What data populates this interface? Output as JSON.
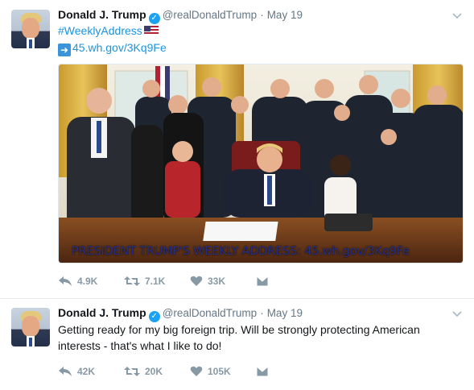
{
  "tweets": [
    {
      "author": {
        "name": "Donald J. Trump",
        "handle": "@realDonaldTrump",
        "verified_icon": "verified-badge-icon"
      },
      "time": "May 19",
      "lines": {
        "hashtag": "#WeeklyAddress",
        "link": "45.wh.gov/3Kq9Fe"
      },
      "media": {
        "caption": "PRESIDENT TRUMP'S WEEKLY ADDRESS: 45.wh.gov/3Kq9Fe"
      },
      "stats": {
        "replies": "4.9K",
        "retweets": "7.1K",
        "likes": "33K"
      }
    },
    {
      "author": {
        "name": "Donald J. Trump",
        "handle": "@realDonaldTrump",
        "verified_icon": "verified-badge-icon"
      },
      "time": "May 19",
      "lines": {
        "line1": "Getting ready for my big foreign trip. Will be strongly protecting American",
        "line2": "interests - that's what I like to do!"
      },
      "stats": {
        "replies": "42K",
        "retweets": "20K",
        "likes": "105K"
      }
    }
  ],
  "colors": {
    "accent": "#1b95e0",
    "muted": "#657786",
    "action": "#8899a6",
    "verified": "#1da1f2",
    "caption": "#24308a"
  },
  "icons": [
    "reply-icon",
    "retweet-icon",
    "like-icon",
    "dm-icon",
    "chevron-down-icon",
    "us-flag-icon",
    "right-arrow-icon"
  ]
}
